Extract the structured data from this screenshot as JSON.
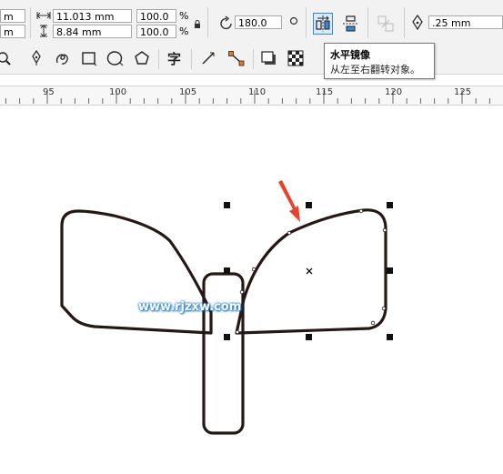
{
  "property_bar": {
    "x_value": "m",
    "y_value": "m",
    "width_value": "11.013 mm",
    "height_value": "8.84 mm",
    "scale_x": "100.0",
    "scale_y": "100.0",
    "percent_symbol": "%",
    "rotation": "180.0",
    "outline_width": ".25 mm"
  },
  "tooltip": {
    "title": "水平镜像",
    "description": "从左至右翻转对象。"
  },
  "ruler": {
    "labels": [
      "95",
      "100",
      "105",
      "110",
      "115",
      "120",
      "125"
    ]
  },
  "watermark": "www.rjzxw.com",
  "colors": {
    "accent": "#3a86d6",
    "arrow": "#e8412c",
    "shape_stroke": "#231815"
  }
}
